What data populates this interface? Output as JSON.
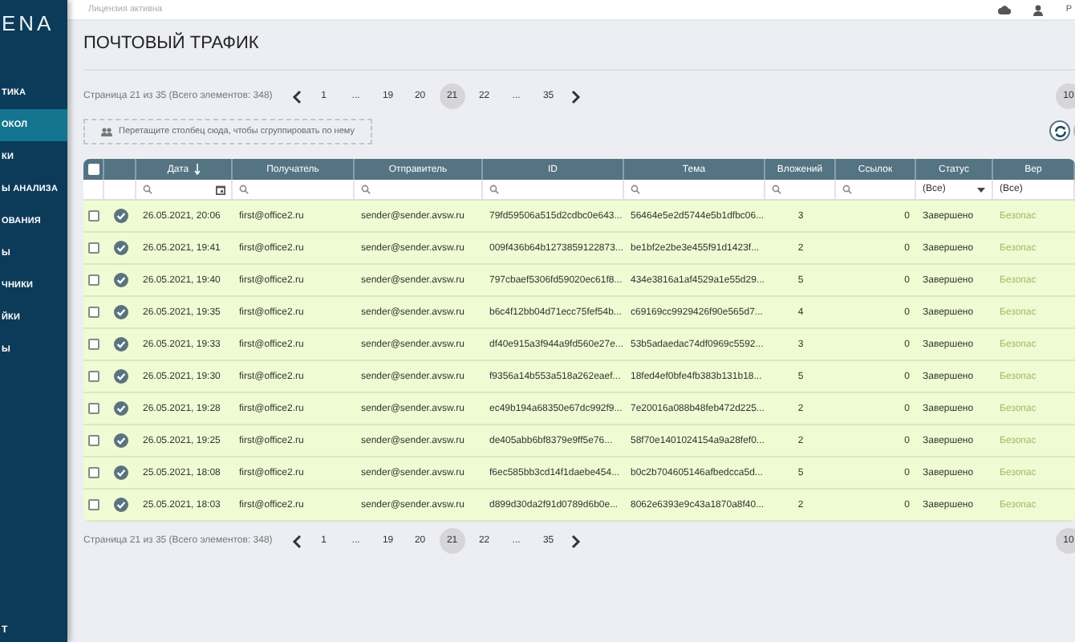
{
  "sidebar": {
    "logo": "ENA",
    "items": [
      {
        "label": "ТИКА",
        "selected": false
      },
      {
        "label": "ОКОЛ",
        "selected": true
      },
      {
        "label": "КИ",
        "selected": false
      },
      {
        "label": "Ы АНАЛИЗА",
        "selected": false
      },
      {
        "label": "ОВАНИЯ",
        "selected": false
      },
      {
        "label": "Ы",
        "selected": false
      },
      {
        "label": "ЧНИКИ",
        "selected": false
      },
      {
        "label": "ЙКИ",
        "selected": false
      },
      {
        "label": "Ы",
        "selected": false
      }
    ],
    "footer": "Т"
  },
  "topbar": {
    "license": "Лицензия активна",
    "user": "Р"
  },
  "title": "ПОЧТОВЫЙ ТРАФИК",
  "pagers": [
    {
      "summary": "Страница 21 из 35 (Всего элементов: 348)",
      "pages": [
        {
          "label": "1",
          "selected": false
        },
        {
          "label": "...",
          "selected": false
        },
        {
          "label": "19",
          "selected": false
        },
        {
          "label": "20",
          "selected": false
        },
        {
          "label": "21",
          "selected": true
        },
        {
          "label": "22",
          "selected": false
        },
        {
          "label": "...",
          "selected": false
        },
        {
          "label": "35",
          "selected": false
        }
      ],
      "page_size": "10"
    },
    {
      "summary": "Страница 21 из 35 (Всего элементов: 348)",
      "pages": [
        {
          "label": "1",
          "selected": false
        },
        {
          "label": "...",
          "selected": false
        },
        {
          "label": "19",
          "selected": false
        },
        {
          "label": "20",
          "selected": false
        },
        {
          "label": "21",
          "selected": true
        },
        {
          "label": "22",
          "selected": false
        },
        {
          "label": "...",
          "selected": false
        },
        {
          "label": "35",
          "selected": false
        }
      ],
      "page_size": "10"
    }
  ],
  "group_panel": "Перетащите столбец сюда, чтобы сгруппировать по нему",
  "table": {
    "all_checked": false,
    "columns": [
      {
        "label": "Дата",
        "filter": {
          "kind": "date"
        },
        "sorted": true
      },
      {
        "label": "Получатель",
        "filter": {
          "kind": "search"
        },
        "sorted": false
      },
      {
        "label": "Отправитель",
        "filter": {
          "kind": "search"
        },
        "sorted": false
      },
      {
        "label": "ID",
        "filter": {
          "kind": "search"
        },
        "sorted": false
      },
      {
        "label": "Тема",
        "filter": {
          "kind": "search"
        },
        "sorted": false
      },
      {
        "label": "Вложений",
        "filter": {
          "kind": "search"
        },
        "sorted": false
      },
      {
        "label": "Ссылок",
        "filter": {
          "kind": "search"
        },
        "sorted": false
      },
      {
        "label": "Статус",
        "filter": {
          "kind": "select",
          "value": "(Все)"
        },
        "sorted": false
      },
      {
        "label": "Вер",
        "filter": {
          "kind": "select",
          "value": "(Все)"
        },
        "sorted": false
      }
    ],
    "rows": [
      {
        "checked": false,
        "cells": [
          "26.05.2021, 20:06",
          "first@office2.ru",
          "sender@sender.avsw.ru",
          "79fd59506a515d2cdbc0e643...",
          "56464e5e2d5744e5b1dfbc06...",
          "3",
          "0",
          "Завершено",
          "Безопас"
        ]
      },
      {
        "checked": false,
        "cells": [
          "26.05.2021, 19:41",
          "first@office2.ru",
          "sender@sender.avsw.ru",
          "009f436b64b1273859122873...",
          "be1bf2e2be3e455f91d1423f...",
          "2",
          "0",
          "Завершено",
          "Безопас"
        ]
      },
      {
        "checked": false,
        "cells": [
          "26.05.2021, 19:40",
          "first@office2.ru",
          "sender@sender.avsw.ru",
          "797cbaef5306fd59020ec61f8...",
          "434e3816a1af4529a1e55d29...",
          "5",
          "0",
          "Завершено",
          "Безопас"
        ]
      },
      {
        "checked": false,
        "cells": [
          "26.05.2021, 19:35",
          "first@office2.ru",
          "sender@sender.avsw.ru",
          "b6c4f12bb04d71ecc75fef54b...",
          "c69169cc9929426f90e565d7...",
          "4",
          "0",
          "Завершено",
          "Безопас"
        ]
      },
      {
        "checked": false,
        "cells": [
          "26.05.2021, 19:33",
          "first@office2.ru",
          "sender@sender.avsw.ru",
          "df40e915a3f944a9fd560e27e...",
          "53b5adaedac74df0969c5592...",
          "3",
          "0",
          "Завершено",
          "Безопас"
        ]
      },
      {
        "checked": false,
        "cells": [
          "26.05.2021, 19:30",
          "first@office2.ru",
          "sender@sender.avsw.ru",
          "f9356a14b553a518a262eaef...",
          "18fed4ef0bfe4fb383b131b18...",
          "5",
          "0",
          "Завершено",
          "Безопас"
        ]
      },
      {
        "checked": false,
        "cells": [
          "26.05.2021, 19:28",
          "first@office2.ru",
          "sender@sender.avsw.ru",
          "ec49b194a68350e67dc992f9...",
          "7e20016a088b48feb472d225...",
          "2",
          "0",
          "Завершено",
          "Безопас"
        ]
      },
      {
        "checked": false,
        "cells": [
          "26.05.2021, 19:25",
          "first@office2.ru",
          "sender@sender.avsw.ru",
          "de405abb6bf8379e9ff5e76...",
          "58f70e1401024154a9a28fef0...",
          "2",
          "0",
          "Завершено",
          "Безопас"
        ]
      },
      {
        "checked": false,
        "cells": [
          "25.05.2021, 18:08",
          "first@office2.ru",
          "sender@sender.avsw.ru",
          "f6ec585bb3cd14f1daebe454...",
          "b0c2b704605146afbedcca5d...",
          "5",
          "0",
          "Завершено",
          "Безопас"
        ]
      },
      {
        "checked": false,
        "cells": [
          "25.05.2021, 18:03",
          "first@office2.ru",
          "sender@sender.avsw.ru",
          "d899d30da2f91d0789d6b0e...",
          "8062e6393e9c43a1870a8f40...",
          "2",
          "0",
          "Завершено",
          "Безопас"
        ]
      }
    ]
  }
}
